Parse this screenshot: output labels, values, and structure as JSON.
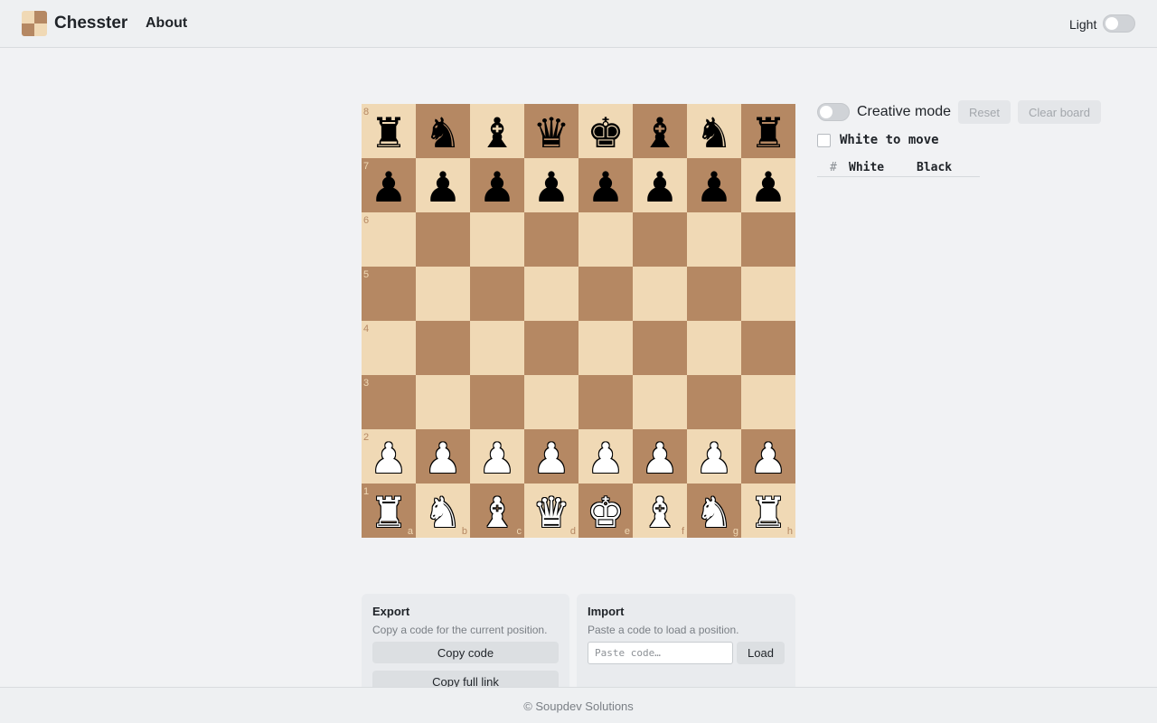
{
  "header": {
    "brand": "Chesster",
    "nav_about": "About",
    "theme_label": "Light",
    "logo_icon": "chess-board-logo-icon"
  },
  "board": {
    "ranks": [
      "8",
      "7",
      "6",
      "5",
      "4",
      "3",
      "2",
      "1"
    ],
    "files": [
      "a",
      "b",
      "c",
      "d",
      "e",
      "f",
      "g",
      "h"
    ],
    "colors": {
      "light": "#f0d9b5",
      "dark": "#b58863"
    },
    "rows": [
      [
        "♜",
        "♞",
        "♝",
        "♛",
        "♚",
        "♝",
        "♞",
        "♜"
      ],
      [
        "♟",
        "♟",
        "♟",
        "♟",
        "♟",
        "♟",
        "♟",
        "♟"
      ],
      [
        "",
        "",
        "",
        "",
        "",
        "",
        "",
        ""
      ],
      [
        "",
        "",
        "",
        "",
        "",
        "",
        "",
        ""
      ],
      [
        "",
        "",
        "",
        "",
        "",
        "",
        "",
        ""
      ],
      [
        "",
        "",
        "",
        "",
        "",
        "",
        "",
        ""
      ],
      [
        "♟",
        "♟",
        "♟",
        "♟",
        "♟",
        "♟",
        "♟",
        "♟"
      ],
      [
        "♜",
        "♞",
        "♝",
        "♛",
        "♚",
        "♝",
        "♞",
        "♜"
      ]
    ],
    "piece_colors": [
      "black",
      "black",
      "",
      "",
      "",
      "",
      "white",
      "white"
    ]
  },
  "panel": {
    "creative_mode_label": "Creative mode",
    "reset_label": "Reset",
    "clear_board_label": "Clear board",
    "turn_text": "White to move",
    "moves_header": {
      "num": "#",
      "white": "White",
      "black": "Black"
    }
  },
  "export": {
    "title": "Export",
    "description": "Copy a code for the current position.",
    "copy_code_label": "Copy code",
    "copy_link_label": "Copy full link"
  },
  "import": {
    "title": "Import",
    "description": "Paste a code to load a position.",
    "input_placeholder": "Paste code…",
    "input_value": "",
    "load_label": "Load"
  },
  "footer": {
    "text": "© Soupdev Solutions"
  }
}
